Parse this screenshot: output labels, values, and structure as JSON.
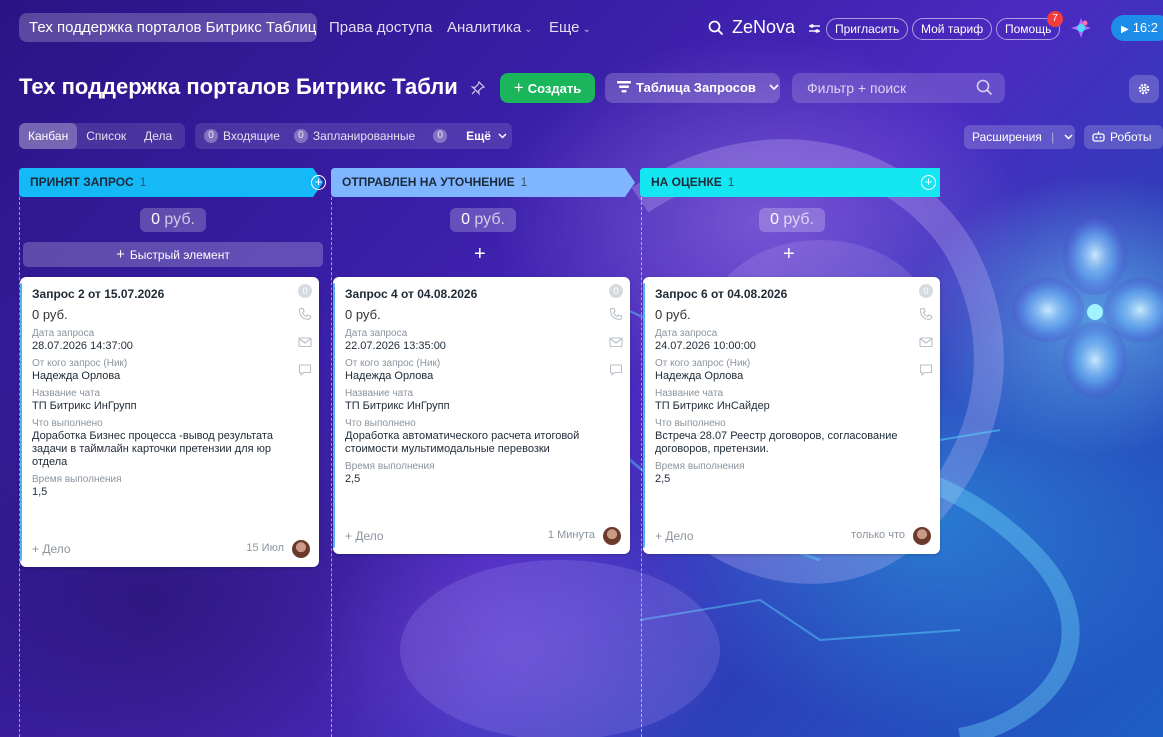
{
  "topbar": {
    "active_tab": "Тех поддержка порталов Битрикс Таблиц...",
    "nav": [
      {
        "label": "Права доступа",
        "chevron": ""
      },
      {
        "label": "Аналитика",
        "chevron": "⌄"
      },
      {
        "label": "Еще",
        "chevron": "⌄"
      }
    ],
    "logo": "ZeNova",
    "invite": "Пригласить",
    "tariff": "Мой тариф",
    "help": "Помощь",
    "help_badge": "7",
    "time": "16:2"
  },
  "toolbar": {
    "title": "Тех поддержка порталов Битрикс Табли...",
    "create": "Создать",
    "table": "Таблица Запросов",
    "search_placeholder": "Фильтр + поиск"
  },
  "views": [
    "Канбан",
    "Список",
    "Дела"
  ],
  "counters": [
    {
      "num": "0",
      "label": "Входящие"
    },
    {
      "num": "0",
      "label": "Запланированные"
    },
    {
      "num": "0",
      "label": ""
    }
  ],
  "counters_more": "Ещё",
  "extensions": "Расширения",
  "robots": "Роботы",
  "quick_add": "Быстрый элемент",
  "columns": [
    {
      "title": "Принят запрос",
      "count": "1",
      "sum": "0",
      "currency": "руб.",
      "color": "#15b9f7"
    },
    {
      "title": "Отправлен на уточнение",
      "count": "1",
      "sum": "0",
      "currency": "руб.",
      "color": "#7fb6ff"
    },
    {
      "title": "На оценке",
      "count": "1",
      "sum": "0",
      "currency": "руб.",
      "color": "#14e6f2"
    }
  ],
  "cards": [
    {
      "title": "Запрос 2 от 15.07.2026",
      "sum": "0 руб.",
      "counter": "0",
      "fields": [
        {
          "label": "Дата запроса",
          "value": "28.07.2026 14:37:00"
        },
        {
          "label": "От кого запрос (Ник)",
          "value": "Надежда Орлова"
        },
        {
          "label": "Название чата",
          "value": "ТП Битрикс ИнГрупп"
        },
        {
          "label": "Что выполнено",
          "value": "Доработка Бизнес процесса -вывод результата задачи в таймлайн карточки претензии для юр отдела"
        },
        {
          "label": "Время выполнения",
          "value": "1,5"
        }
      ],
      "deal": "+ Дело",
      "when": "15 Июл"
    },
    {
      "title": "Запрос 4 от 04.08.2026",
      "sum": "0 руб.",
      "counter": "0",
      "fields": [
        {
          "label": "Дата запроса",
          "value": "22.07.2026 13:35:00"
        },
        {
          "label": "От кого запрос (Ник)",
          "value": "Надежда Орлова"
        },
        {
          "label": "Название чата",
          "value": "ТП Битрикс ИнГрупп"
        },
        {
          "label": "Что выполнено",
          "value": "Доработка автоматического расчета итоговой стоимости мультимодальные перевозки"
        },
        {
          "label": "Время выполнения",
          "value": "2,5"
        }
      ],
      "deal": "+ Дело",
      "when": "1 Минута"
    },
    {
      "title": "Запрос 6 от 04.08.2026",
      "sum": "0 руб.",
      "counter": "0",
      "fields": [
        {
          "label": "Дата запроса",
          "value": "24.07.2026 10:00:00"
        },
        {
          "label": "От кого запрос (Ник)",
          "value": "Надежда Орлова"
        },
        {
          "label": "Название чата",
          "value": "ТП Битрикс ИнСайдер"
        },
        {
          "label": "Что выполнено",
          "value": "Встреча 28.07 Реестр договоров, согласование договоров, претензии."
        },
        {
          "label": "Время выполнения",
          "value": "2,5"
        }
      ],
      "deal": "+ Дело",
      "when": "только что"
    }
  ]
}
